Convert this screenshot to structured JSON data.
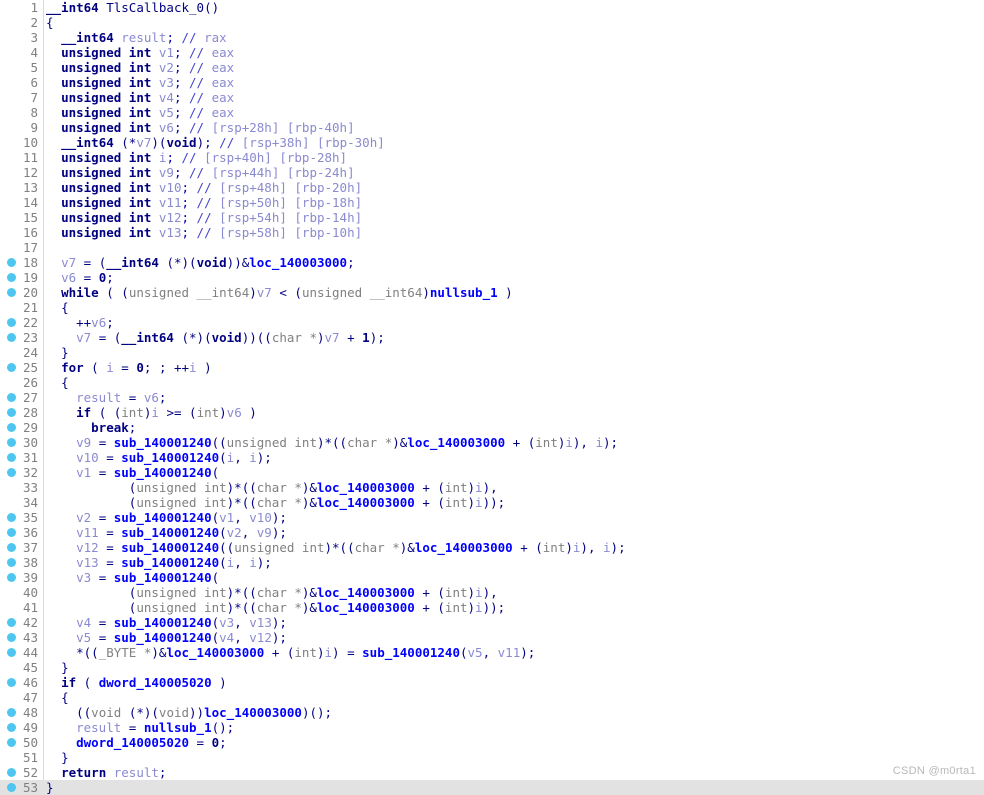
{
  "view": {
    "title": "Pseudocode-A",
    "function_name": "TlsCallback_0",
    "watermark": "CSDN @m0rta1",
    "colors": {
      "background": "#ffffff",
      "gutter_rule": "#d9d9e2",
      "line_number": "#808080",
      "breakpoint_dot": "#4ec6f0",
      "current_line_highlight": "#e2e2e2",
      "keyword": "#000080",
      "variable": "#8a8ad0",
      "function": "#0000ff",
      "cast_type": "#808080",
      "comment": "#8a8ad0",
      "watermark": "#b8b8b8"
    },
    "total_lines": 53,
    "current_line": 53
  },
  "lines": [
    {
      "n": 1,
      "dot": false,
      "html": "<span class=\"t-kw\">__int64</span> <span class=\"t-name\">TlsCallback_0</span><span class=\"t-punct\">()</span>"
    },
    {
      "n": 2,
      "dot": false,
      "html": "<span class=\"t-punct\">{</span>"
    },
    {
      "n": 3,
      "dot": false,
      "html": "  <span class=\"t-kw\">__int64</span> <span class=\"t-var\">result</span>; <span class=\"t-cmt\">//</span> <span class=\"t-cmtx\">rax</span>"
    },
    {
      "n": 4,
      "dot": false,
      "html": "  <span class=\"t-kw\">unsigned int</span> <span class=\"t-var\">v1</span>; <span class=\"t-cmt\">//</span> <span class=\"t-cmtx\">eax</span>"
    },
    {
      "n": 5,
      "dot": false,
      "html": "  <span class=\"t-kw\">unsigned int</span> <span class=\"t-var\">v2</span>; <span class=\"t-cmt\">//</span> <span class=\"t-cmtx\">eax</span>"
    },
    {
      "n": 6,
      "dot": false,
      "html": "  <span class=\"t-kw\">unsigned int</span> <span class=\"t-var\">v3</span>; <span class=\"t-cmt\">//</span> <span class=\"t-cmtx\">eax</span>"
    },
    {
      "n": 7,
      "dot": false,
      "html": "  <span class=\"t-kw\">unsigned int</span> <span class=\"t-var\">v4</span>; <span class=\"t-cmt\">//</span> <span class=\"t-cmtx\">eax</span>"
    },
    {
      "n": 8,
      "dot": false,
      "html": "  <span class=\"t-kw\">unsigned int</span> <span class=\"t-var\">v5</span>; <span class=\"t-cmt\">//</span> <span class=\"t-cmtx\">eax</span>"
    },
    {
      "n": 9,
      "dot": false,
      "html": "  <span class=\"t-kw\">unsigned int</span> <span class=\"t-var\">v6</span>; <span class=\"t-cmt\">//</span> <span class=\"t-cmtx\">[rsp+28h] [rbp-40h]</span>"
    },
    {
      "n": 10,
      "dot": false,
      "html": "  <span class=\"t-kw\">__int64</span> <span class=\"t-punct\">(*</span><span class=\"t-var\">v7</span><span class=\"t-punct\">)(</span><span class=\"t-kw\">void</span><span class=\"t-punct\">)</span>; <span class=\"t-cmt\">//</span> <span class=\"t-cmtx\">[rsp+38h] [rbp-30h]</span>"
    },
    {
      "n": 11,
      "dot": false,
      "html": "  <span class=\"t-kw\">unsigned int</span> <span class=\"t-var\">i</span>; <span class=\"t-cmt\">//</span> <span class=\"t-cmtx\">[rsp+40h] [rbp-28h]</span>"
    },
    {
      "n": 12,
      "dot": false,
      "html": "  <span class=\"t-kw\">unsigned int</span> <span class=\"t-var\">v9</span>; <span class=\"t-cmt\">//</span> <span class=\"t-cmtx\">[rsp+44h] [rbp-24h]</span>"
    },
    {
      "n": 13,
      "dot": false,
      "html": "  <span class=\"t-kw\">unsigned int</span> <span class=\"t-var\">v10</span>; <span class=\"t-cmt\">//</span> <span class=\"t-cmtx\">[rsp+48h] [rbp-20h]</span>"
    },
    {
      "n": 14,
      "dot": false,
      "html": "  <span class=\"t-kw\">unsigned int</span> <span class=\"t-var\">v11</span>; <span class=\"t-cmt\">//</span> <span class=\"t-cmtx\">[rsp+50h] [rbp-18h]</span>"
    },
    {
      "n": 15,
      "dot": false,
      "html": "  <span class=\"t-kw\">unsigned int</span> <span class=\"t-var\">v12</span>; <span class=\"t-cmt\">//</span> <span class=\"t-cmtx\">[rsp+54h] [rbp-14h]</span>"
    },
    {
      "n": 16,
      "dot": false,
      "html": "  <span class=\"t-kw\">unsigned int</span> <span class=\"t-var\">v13</span>; <span class=\"t-cmt\">//</span> <span class=\"t-cmtx\">[rsp+58h] [rbp-10h]</span>"
    },
    {
      "n": 17,
      "dot": false,
      "html": ""
    },
    {
      "n": 18,
      "dot": true,
      "html": "  <span class=\"t-var\">v7</span> <span class=\"t-punct\">= (</span><span class=\"t-kw\">__int64</span> <span class=\"t-punct\">(*)(</span><span class=\"t-kw\">void</span><span class=\"t-punct\">))&amp;</span><span class=\"t-fn\">loc_140003000</span><span class=\"t-punct\">;</span>"
    },
    {
      "n": 19,
      "dot": true,
      "html": "  <span class=\"t-var\">v6</span> <span class=\"t-punct\">=</span> <span class=\"t-num\">0</span><span class=\"t-punct\">;</span>"
    },
    {
      "n": 20,
      "dot": true,
      "html": "  <span class=\"t-kw\">while</span> <span class=\"t-punct\">( (</span><span class=\"t-type\">unsigned __int64</span><span class=\"t-punct\">)</span><span class=\"t-var\">v7</span> <span class=\"t-punct\">&lt; (</span><span class=\"t-type\">unsigned __int64</span><span class=\"t-punct\">)</span><span class=\"t-fn\">nullsub_1</span> <span class=\"t-punct\">)</span>"
    },
    {
      "n": 21,
      "dot": false,
      "html": "  <span class=\"t-punct\">{</span>"
    },
    {
      "n": 22,
      "dot": true,
      "html": "    <span class=\"t-punct\">++</span><span class=\"t-var\">v6</span><span class=\"t-punct\">;</span>"
    },
    {
      "n": 23,
      "dot": true,
      "html": "    <span class=\"t-var\">v7</span> <span class=\"t-punct\">= (</span><span class=\"t-kw\">__int64</span> <span class=\"t-punct\">(*)(</span><span class=\"t-kw\">void</span><span class=\"t-punct\">))((</span><span class=\"t-type\">char *</span><span class=\"t-punct\">)</span><span class=\"t-var\">v7</span> <span class=\"t-punct\">+</span> <span class=\"t-num\">1</span><span class=\"t-punct\">);</span>"
    },
    {
      "n": 24,
      "dot": false,
      "html": "  <span class=\"t-punct\">}</span>"
    },
    {
      "n": 25,
      "dot": true,
      "html": "  <span class=\"t-kw\">for</span> <span class=\"t-punct\">(</span> <span class=\"t-var\">i</span> <span class=\"t-punct\">=</span> <span class=\"t-num\">0</span><span class=\"t-punct\">; ; ++</span><span class=\"t-var\">i</span> <span class=\"t-punct\">)</span>"
    },
    {
      "n": 26,
      "dot": false,
      "html": "  <span class=\"t-punct\">{</span>"
    },
    {
      "n": 27,
      "dot": true,
      "html": "    <span class=\"t-var\">result</span> <span class=\"t-punct\">=</span> <span class=\"t-var\">v6</span><span class=\"t-punct\">;</span>"
    },
    {
      "n": 28,
      "dot": true,
      "html": "    <span class=\"t-kw\">if</span> <span class=\"t-punct\">( (</span><span class=\"t-type\">int</span><span class=\"t-punct\">)</span><span class=\"t-var\">i</span> <span class=\"t-punct\">&gt;= (</span><span class=\"t-type\">int</span><span class=\"t-punct\">)</span><span class=\"t-var\">v6</span> <span class=\"t-punct\">)</span>"
    },
    {
      "n": 29,
      "dot": true,
      "html": "      <span class=\"t-kw\">break</span><span class=\"t-punct\">;</span>"
    },
    {
      "n": 30,
      "dot": true,
      "html": "    <span class=\"t-var\">v9</span> <span class=\"t-punct\">=</span> <span class=\"t-fn\">sub_140001240</span><span class=\"t-punct\">((</span><span class=\"t-type\">unsigned int</span><span class=\"t-punct\">)*((</span><span class=\"t-type\">char *</span><span class=\"t-punct\">)&amp;</span><span class=\"t-fn\">loc_140003000</span> <span class=\"t-punct\">+ (</span><span class=\"t-type\">int</span><span class=\"t-punct\">)</span><span class=\"t-var\">i</span><span class=\"t-punct\">),</span> <span class=\"t-var\">i</span><span class=\"t-punct\">);</span>"
    },
    {
      "n": 31,
      "dot": true,
      "html": "    <span class=\"t-var\">v10</span> <span class=\"t-punct\">=</span> <span class=\"t-fn\">sub_140001240</span><span class=\"t-punct\">(</span><span class=\"t-var\">i</span><span class=\"t-punct\">,</span> <span class=\"t-var\">i</span><span class=\"t-punct\">);</span>"
    },
    {
      "n": 32,
      "dot": true,
      "html": "    <span class=\"t-var\">v1</span> <span class=\"t-punct\">=</span> <span class=\"t-fn\">sub_140001240</span><span class=\"t-punct\">(</span>"
    },
    {
      "n": 33,
      "dot": false,
      "html": "           <span class=\"t-punct\">(</span><span class=\"t-type\">unsigned int</span><span class=\"t-punct\">)*((</span><span class=\"t-type\">char *</span><span class=\"t-punct\">)&amp;</span><span class=\"t-fn\">loc_140003000</span> <span class=\"t-punct\">+ (</span><span class=\"t-type\">int</span><span class=\"t-punct\">)</span><span class=\"t-var\">i</span><span class=\"t-punct\">),</span>"
    },
    {
      "n": 34,
      "dot": false,
      "html": "           <span class=\"t-punct\">(</span><span class=\"t-type\">unsigned int</span><span class=\"t-punct\">)*((</span><span class=\"t-type\">char *</span><span class=\"t-punct\">)&amp;</span><span class=\"t-fn\">loc_140003000</span> <span class=\"t-punct\">+ (</span><span class=\"t-type\">int</span><span class=\"t-punct\">)</span><span class=\"t-var\">i</span><span class=\"t-punct\">));</span>"
    },
    {
      "n": 35,
      "dot": true,
      "html": "    <span class=\"t-var\">v2</span> <span class=\"t-punct\">=</span> <span class=\"t-fn\">sub_140001240</span><span class=\"t-punct\">(</span><span class=\"t-var\">v1</span><span class=\"t-punct\">,</span> <span class=\"t-var\">v10</span><span class=\"t-punct\">);</span>"
    },
    {
      "n": 36,
      "dot": true,
      "html": "    <span class=\"t-var\">v11</span> <span class=\"t-punct\">=</span> <span class=\"t-fn\">sub_140001240</span><span class=\"t-punct\">(</span><span class=\"t-var\">v2</span><span class=\"t-punct\">,</span> <span class=\"t-var\">v9</span><span class=\"t-punct\">);</span>"
    },
    {
      "n": 37,
      "dot": true,
      "html": "    <span class=\"t-var\">v12</span> <span class=\"t-punct\">=</span> <span class=\"t-fn\">sub_140001240</span><span class=\"t-punct\">((</span><span class=\"t-type\">unsigned int</span><span class=\"t-punct\">)*((</span><span class=\"t-type\">char *</span><span class=\"t-punct\">)&amp;</span><span class=\"t-fn\">loc_140003000</span> <span class=\"t-punct\">+ (</span><span class=\"t-type\">int</span><span class=\"t-punct\">)</span><span class=\"t-var\">i</span><span class=\"t-punct\">),</span> <span class=\"t-var\">i</span><span class=\"t-punct\">);</span>"
    },
    {
      "n": 38,
      "dot": true,
      "html": "    <span class=\"t-var\">v13</span> <span class=\"t-punct\">=</span> <span class=\"t-fn\">sub_140001240</span><span class=\"t-punct\">(</span><span class=\"t-var\">i</span><span class=\"t-punct\">,</span> <span class=\"t-var\">i</span><span class=\"t-punct\">);</span>"
    },
    {
      "n": 39,
      "dot": true,
      "html": "    <span class=\"t-var\">v3</span> <span class=\"t-punct\">=</span> <span class=\"t-fn\">sub_140001240</span><span class=\"t-punct\">(</span>"
    },
    {
      "n": 40,
      "dot": false,
      "html": "           <span class=\"t-punct\">(</span><span class=\"t-type\">unsigned int</span><span class=\"t-punct\">)*((</span><span class=\"t-type\">char *</span><span class=\"t-punct\">)&amp;</span><span class=\"t-fn\">loc_140003000</span> <span class=\"t-punct\">+ (</span><span class=\"t-type\">int</span><span class=\"t-punct\">)</span><span class=\"t-var\">i</span><span class=\"t-punct\">),</span>"
    },
    {
      "n": 41,
      "dot": false,
      "html": "           <span class=\"t-punct\">(</span><span class=\"t-type\">unsigned int</span><span class=\"t-punct\">)*((</span><span class=\"t-type\">char *</span><span class=\"t-punct\">)&amp;</span><span class=\"t-fn\">loc_140003000</span> <span class=\"t-punct\">+ (</span><span class=\"t-type\">int</span><span class=\"t-punct\">)</span><span class=\"t-var\">i</span><span class=\"t-punct\">));</span>"
    },
    {
      "n": 42,
      "dot": true,
      "html": "    <span class=\"t-var\">v4</span> <span class=\"t-punct\">=</span> <span class=\"t-fn\">sub_140001240</span><span class=\"t-punct\">(</span><span class=\"t-var\">v3</span><span class=\"t-punct\">,</span> <span class=\"t-var\">v13</span><span class=\"t-punct\">);</span>"
    },
    {
      "n": 43,
      "dot": true,
      "html": "    <span class=\"t-var\">v5</span> <span class=\"t-punct\">=</span> <span class=\"t-fn\">sub_140001240</span><span class=\"t-punct\">(</span><span class=\"t-var\">v4</span><span class=\"t-punct\">,</span> <span class=\"t-var\">v12</span><span class=\"t-punct\">);</span>"
    },
    {
      "n": 44,
      "dot": true,
      "html": "    <span class=\"t-punct\">*((</span><span class=\"t-type\">_BYTE *</span><span class=\"t-punct\">)&amp;</span><span class=\"t-fn\">loc_140003000</span> <span class=\"t-punct\">+ (</span><span class=\"t-type\">int</span><span class=\"t-punct\">)</span><span class=\"t-var\">i</span><span class=\"t-punct\">) =</span> <span class=\"t-fn\">sub_140001240</span><span class=\"t-punct\">(</span><span class=\"t-var\">v5</span><span class=\"t-punct\">,</span> <span class=\"t-var\">v11</span><span class=\"t-punct\">);</span>"
    },
    {
      "n": 45,
      "dot": false,
      "html": "  <span class=\"t-punct\">}</span>"
    },
    {
      "n": 46,
      "dot": true,
      "html": "  <span class=\"t-kw\">if</span> <span class=\"t-punct\">(</span> <span class=\"t-fn\">dword_140005020</span> <span class=\"t-punct\">)</span>"
    },
    {
      "n": 47,
      "dot": false,
      "html": "  <span class=\"t-punct\">{</span>"
    },
    {
      "n": 48,
      "dot": true,
      "html": "    <span class=\"t-punct\">((</span><span class=\"t-type\">void</span> <span class=\"t-punct\">(*)(</span><span class=\"t-type\">void</span><span class=\"t-punct\">))</span><span class=\"t-fn\">loc_140003000</span><span class=\"t-punct\">)();</span>"
    },
    {
      "n": 49,
      "dot": true,
      "html": "    <span class=\"t-var\">result</span> <span class=\"t-punct\">=</span> <span class=\"t-fn\">nullsub_1</span><span class=\"t-punct\">();</span>"
    },
    {
      "n": 50,
      "dot": true,
      "html": "    <span class=\"t-fn\">dword_140005020</span> <span class=\"t-punct\">=</span> <span class=\"t-num\">0</span><span class=\"t-punct\">;</span>"
    },
    {
      "n": 51,
      "dot": false,
      "html": "  <span class=\"t-punct\">}</span>"
    },
    {
      "n": 52,
      "dot": true,
      "html": "  <span class=\"t-kw\">return</span> <span class=\"t-var\">result</span><span class=\"t-punct\">;</span>"
    },
    {
      "n": 53,
      "dot": true,
      "html": "<span class=\"t-punct\">}</span>",
      "current": true
    }
  ],
  "source_text": {
    "1": "__int64 TlsCallback_0()",
    "2": "{",
    "3": "  __int64 result; // rax",
    "4": "  unsigned int v1; // eax",
    "5": "  unsigned int v2; // eax",
    "6": "  unsigned int v3; // eax",
    "7": "  unsigned int v4; // eax",
    "8": "  unsigned int v5; // eax",
    "9": "  unsigned int v6; // [rsp+28h] [rbp-40h]",
    "10": "  __int64 (*v7)(void); // [rsp+38h] [rbp-30h]",
    "11": "  unsigned int i; // [rsp+40h] [rbp-28h]",
    "12": "  unsigned int v9; // [rsp+44h] [rbp-24h]",
    "13": "  unsigned int v10; // [rsp+48h] [rbp-20h]",
    "14": "  unsigned int v11; // [rsp+50h] [rbp-18h]",
    "15": "  unsigned int v12; // [rsp+54h] [rbp-14h]",
    "16": "  unsigned int v13; // [rsp+58h] [rbp-10h]",
    "17": "",
    "18": "  v7 = (__int64 (*)(void))&loc_140003000;",
    "19": "  v6 = 0;",
    "20": "  while ( (unsigned __int64)v7 < (unsigned __int64)nullsub_1 )",
    "21": "  {",
    "22": "    ++v6;",
    "23": "    v7 = (__int64 (*)(void))((char *)v7 + 1);",
    "24": "  }",
    "25": "  for ( i = 0; ; ++i )",
    "26": "  {",
    "27": "    result = v6;",
    "28": "    if ( (int)i >= (int)v6 )",
    "29": "      break;",
    "30": "    v9 = sub_140001240((unsigned int)*((char *)&loc_140003000 + (int)i), i);",
    "31": "    v10 = sub_140001240(i, i);",
    "32": "    v1 = sub_140001240(",
    "33": "           (unsigned int)*((char *)&loc_140003000 + (int)i),",
    "34": "           (unsigned int)*((char *)&loc_140003000 + (int)i));",
    "35": "    v2 = sub_140001240(v1, v10);",
    "36": "    v11 = sub_140001240(v2, v9);",
    "37": "    v12 = sub_140001240((unsigned int)*((char *)&loc_140003000 + (int)i), i);",
    "38": "    v13 = sub_140001240(i, i);",
    "39": "    v3 = sub_140001240(",
    "40": "           (unsigned int)*((char *)&loc_140003000 + (int)i),",
    "41": "           (unsigned int)*((char *)&loc_140003000 + (int)i));",
    "42": "    v4 = sub_140001240(v3, v13);",
    "43": "    v5 = sub_140001240(v4, v12);",
    "44": "    *((_BYTE *)&loc_140003000 + (int)i) = sub_140001240(v5, v11);",
    "45": "  }",
    "46": "  if ( dword_140005020 )",
    "47": "  {",
    "48": "    ((void (*)(void))loc_140003000)();",
    "49": "    result = nullsub_1();",
    "50": "    dword_140005020 = 0;",
    "51": "  }",
    "52": "  return result;",
    "53": "}"
  }
}
